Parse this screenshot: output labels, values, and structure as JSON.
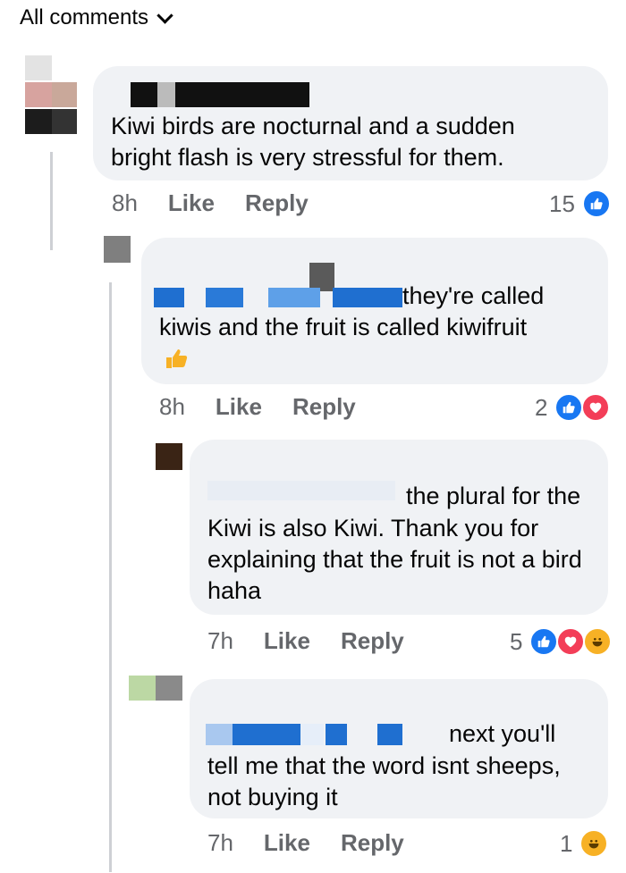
{
  "header": {
    "all_comments": "All comments"
  },
  "comments": [
    {
      "text": "Kiwi birds are nocturnal and a sudden bright flash is very stressful for them.",
      "time": "8h",
      "like": "Like",
      "reply": "Reply",
      "count": "15",
      "reactions": [
        "like"
      ]
    },
    {
      "text_line1": "they're called",
      "text_line2": "kiwis and the fruit is called kiwifruit",
      "time": "8h",
      "like": "Like",
      "reply": "Reply",
      "count": "2",
      "reactions": [
        "like",
        "love"
      ]
    },
    {
      "text_line1": "the plural for the",
      "text_rest": "Kiwi is also Kiwi. Thank you for explaining that the fruit is not a bird haha",
      "time": "7h",
      "like": "Like",
      "reply": "Reply",
      "count": "5",
      "reactions": [
        "like",
        "love",
        "haha"
      ]
    },
    {
      "text_line1": "next you'll",
      "text_rest": "tell me that the word isnt sheeps, not buying it",
      "time": "7h",
      "like": "Like",
      "reply": "Reply",
      "count": "1",
      "reactions": [
        "haha"
      ]
    }
  ],
  "colors": {
    "like": "#1877f2",
    "love": "#f33e58",
    "haha": "#f7b125",
    "bubble": "#f0f2f5"
  }
}
